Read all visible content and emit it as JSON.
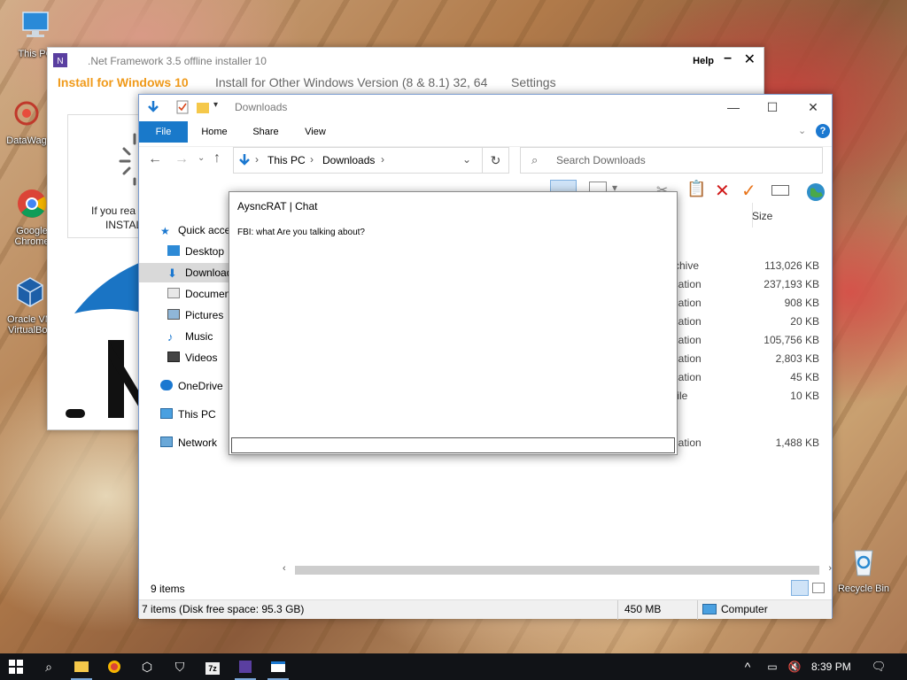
{
  "desktop": {
    "icons": [
      {
        "label": "This PC",
        "icon": "computer-icon"
      },
      {
        "label": "DataWag",
        "icon": "datawag-icon"
      },
      {
        "label": "Google Chrome",
        "icon": "chrome-icon"
      },
      {
        "label": "Oracle VM VirtualBox",
        "icon": "virtualbox-icon"
      },
      {
        "label": "Recycle Bin",
        "icon": "recycle-bin-icon"
      }
    ]
  },
  "net_installer": {
    "title": ".Net Framework 3.5 offline installer 10",
    "help": "Help",
    "minimize": "–",
    "close": "✕",
    "tabs": [
      {
        "label": "Install for Windows 10"
      },
      {
        "label": "Install for Other Windows Version (8 & 8.1) 32, 64"
      },
      {
        "label": "Settings"
      }
    ],
    "panel_text_line1": "If you rea",
    "panel_text_line2": "INSTAL"
  },
  "explorer": {
    "title": "Downloads",
    "ribbon_tabs": [
      {
        "label": "File"
      },
      {
        "label": "Home"
      },
      {
        "label": "Share"
      },
      {
        "label": "View"
      }
    ],
    "breadcrumb": [
      "This PC",
      "Downloads"
    ],
    "search_placeholder": "Search Downloads",
    "nav": [
      {
        "label": "Quick access",
        "icon": "star-icon"
      },
      {
        "label": "Desktop",
        "icon": "desktop-folder-icon"
      },
      {
        "label": "Downloads",
        "icon": "download-folder-icon"
      },
      {
        "label": "Documents",
        "icon": "documents-folder-icon"
      },
      {
        "label": "Pictures",
        "icon": "pictures-folder-icon"
      },
      {
        "label": "Music",
        "icon": "music-folder-icon"
      },
      {
        "label": "Videos",
        "icon": "videos-folder-icon"
      },
      {
        "label": "OneDrive",
        "icon": "onedrive-icon"
      },
      {
        "label": "This PC",
        "icon": "this-pc-icon"
      },
      {
        "label": "Network",
        "icon": "network-icon"
      }
    ],
    "size_header": "Size",
    "files": [
      {
        "type": "rchive",
        "size": "113,026 KB"
      },
      {
        "type": "ication",
        "size": "237,193 KB"
      },
      {
        "type": "ication",
        "size": "908 KB"
      },
      {
        "type": "ication",
        "size": "20 KB"
      },
      {
        "type": "ication",
        "size": "105,756 KB"
      },
      {
        "type": "ication",
        "size": "2,803 KB"
      },
      {
        "type": "ication",
        "size": "45 KB"
      },
      {
        "type": "File",
        "size": "10 KB"
      },
      {
        "type": "ication",
        "size": "1,488 KB"
      }
    ],
    "item_count": "9 items",
    "status_left": "7 items (Disk free space: 95.3 GB)",
    "status_size": "450 MB",
    "status_location": "Computer"
  },
  "chat": {
    "title": "AysncRAT | Chat",
    "message": "FBI: what Are you talking about?",
    "input_value": ""
  },
  "taskbar": {
    "time": "8:39 PM"
  }
}
